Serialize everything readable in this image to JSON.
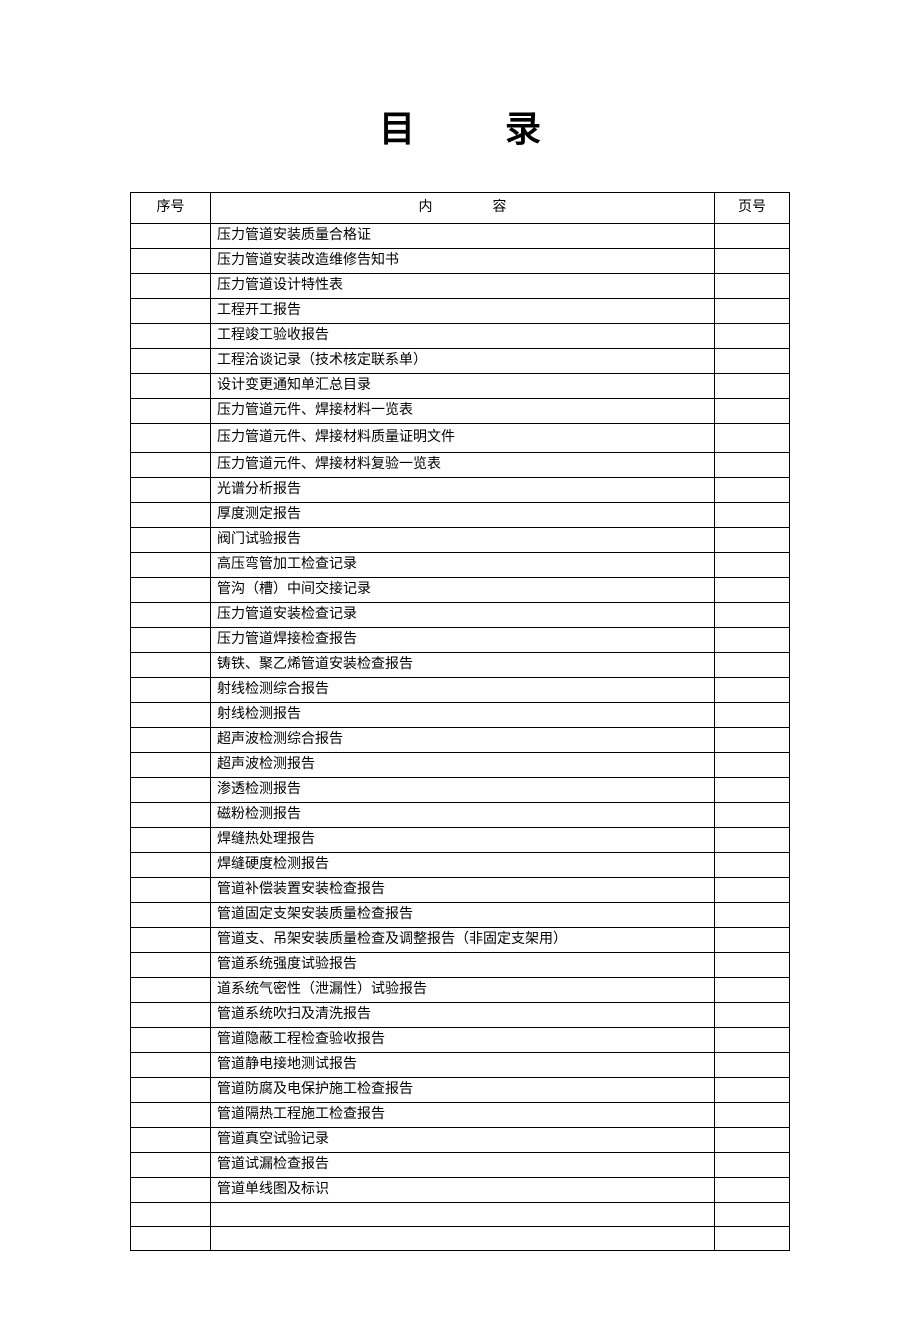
{
  "title": {
    "char1": "目",
    "char2": "录"
  },
  "headers": {
    "seq": "序号",
    "content_char1": "内",
    "content_char2": "容",
    "page": "页号"
  },
  "rows": [
    {
      "seq": "",
      "content": "压力管道安装质量合格证",
      "page": ""
    },
    {
      "seq": "",
      "content": "压力管道安装改造维修告知书",
      "page": ""
    },
    {
      "seq": "",
      "content": "压力管道设计特性表",
      "page": ""
    },
    {
      "seq": "",
      "content": "工程开工报告",
      "page": ""
    },
    {
      "seq": "",
      "content": "工程竣工验收报告",
      "page": ""
    },
    {
      "seq": "",
      "content": "工程洽谈记录（技术核定联系单）",
      "page": ""
    },
    {
      "seq": "",
      "content": "设计变更通知单汇总目录",
      "page": ""
    },
    {
      "seq": "",
      "content": "压力管道元件、焊接材料一览表",
      "page": ""
    },
    {
      "seq": "",
      "content": "压力管道元件、焊接材料质量证明文件",
      "page": "",
      "tall": true
    },
    {
      "seq": "",
      "content": "压力管道元件、焊接材料复验一览表",
      "page": ""
    },
    {
      "seq": "",
      "content": "光谱分析报告",
      "page": ""
    },
    {
      "seq": "",
      "content": "厚度测定报告",
      "page": ""
    },
    {
      "seq": "",
      "content": "阀门试验报告",
      "page": ""
    },
    {
      "seq": "",
      "content": "高压弯管加工检查记录",
      "page": ""
    },
    {
      "seq": "",
      "content": "管沟（槽）中间交接记录",
      "page": ""
    },
    {
      "seq": "",
      "content": "压力管道安装检查记录",
      "page": ""
    },
    {
      "seq": "",
      "content": "压力管道焊接检查报告",
      "page": ""
    },
    {
      "seq": "",
      "content": "铸铁、聚乙烯管道安装检查报告",
      "page": ""
    },
    {
      "seq": "",
      "content": "射线检测综合报告",
      "page": ""
    },
    {
      "seq": "",
      "content": "射线检测报告",
      "page": ""
    },
    {
      "seq": "",
      "content": "超声波检测综合报告",
      "page": ""
    },
    {
      "seq": "",
      "content": "超声波检测报告",
      "page": ""
    },
    {
      "seq": "",
      "content": "渗透检测报告",
      "page": ""
    },
    {
      "seq": "",
      "content": "磁粉检测报告",
      "page": ""
    },
    {
      "seq": "",
      "content": "焊缝热处理报告",
      "page": ""
    },
    {
      "seq": "",
      "content": "焊缝硬度检测报告",
      "page": ""
    },
    {
      "seq": "",
      "content": "管道补偿装置安装检查报告",
      "page": ""
    },
    {
      "seq": "",
      "content": "管道固定支架安装质量检查报告",
      "page": ""
    },
    {
      "seq": "",
      "content": "管道支、吊架安装质量检查及调整报告（非固定支架用）",
      "page": ""
    },
    {
      "seq": "",
      "content": "管道系统强度试验报告",
      "page": ""
    },
    {
      "seq": "",
      "content": "道系统气密性（泄漏性）试验报告",
      "page": ""
    },
    {
      "seq": "",
      "content": "管道系统吹扫及清洗报告",
      "page": ""
    },
    {
      "seq": "",
      "content": "管道隐蔽工程检查验收报告",
      "page": ""
    },
    {
      "seq": "",
      "content": "管道静电接地测试报告",
      "page": ""
    },
    {
      "seq": "",
      "content": "管道防腐及电保护施工检查报告",
      "page": ""
    },
    {
      "seq": "",
      "content": "管道隔热工程施工检查报告",
      "page": ""
    },
    {
      "seq": "",
      "content": "管道真空试验记录",
      "page": ""
    },
    {
      "seq": "",
      "content": "管道试漏检查报告",
      "page": ""
    },
    {
      "seq": "",
      "content": "管道单线图及标识",
      "page": ""
    },
    {
      "seq": "",
      "content": "",
      "page": ""
    },
    {
      "seq": "",
      "content": "",
      "page": ""
    }
  ]
}
